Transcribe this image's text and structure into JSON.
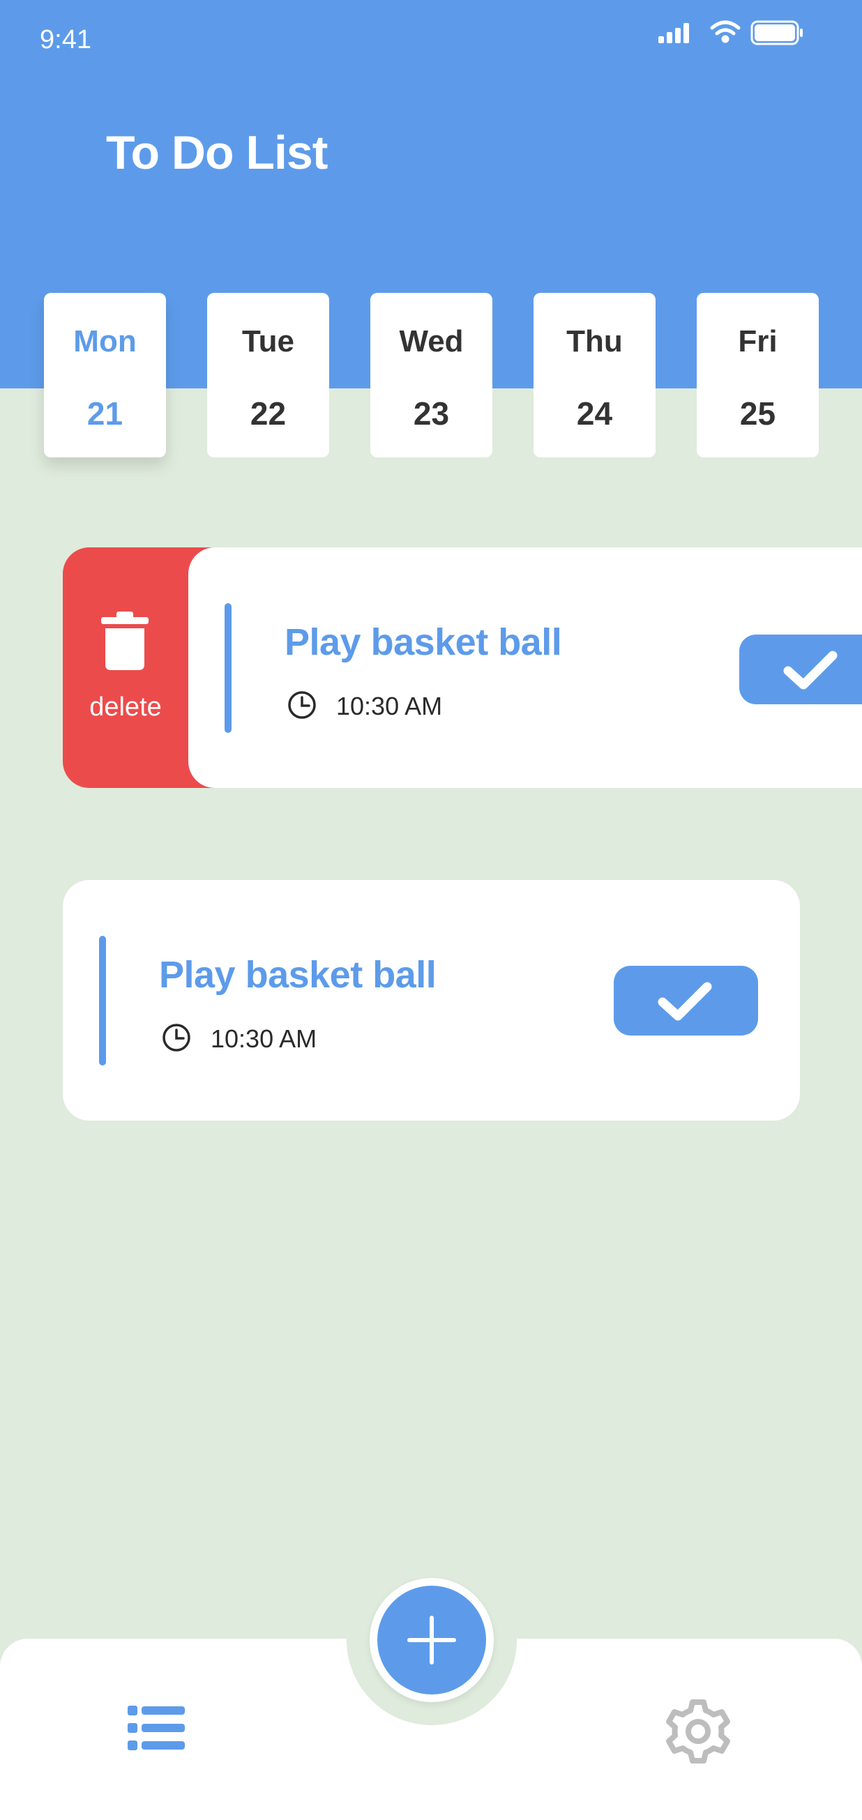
{
  "status_bar": {
    "time": "9:41",
    "icons": [
      "signal-icon",
      "wifi-icon",
      "battery-icon"
    ]
  },
  "header": {
    "title": "To Do List"
  },
  "days": [
    {
      "name": "Mon",
      "number": "21",
      "selected": true
    },
    {
      "name": "Tue",
      "number": "22",
      "selected": false
    },
    {
      "name": "Wed",
      "number": "23",
      "selected": false
    },
    {
      "name": "Thu",
      "number": "24",
      "selected": false
    },
    {
      "name": "Fri",
      "number": "25",
      "selected": false
    }
  ],
  "tasks": [
    {
      "title": "Play basket ball",
      "time": "10:30 AM",
      "swiped": true,
      "delete_label": "delete"
    },
    {
      "title": "Play basket ball",
      "time": "10:30 AM",
      "swiped": false
    }
  ],
  "bottom_nav": {
    "items": [
      "list-icon",
      "plus-icon",
      "gear-icon"
    ]
  },
  "colors": {
    "primary": "#5d9bea",
    "background": "#dfebdc",
    "delete": "#ec4b4c",
    "day_text": "#333333",
    "settings_icon": "#bdbdbd"
  }
}
